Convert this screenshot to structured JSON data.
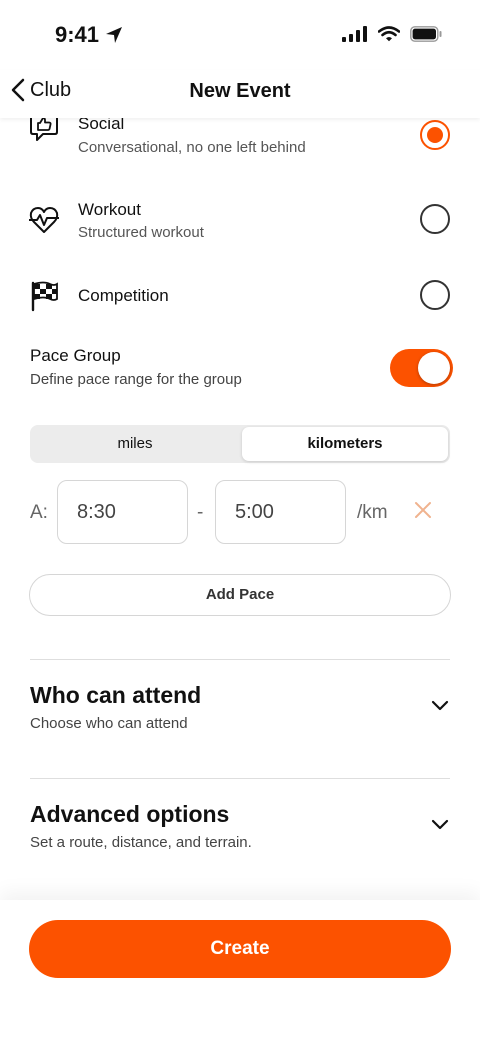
{
  "status_bar": {
    "time": "9:41"
  },
  "nav": {
    "back_label": "Club",
    "title": "New Event"
  },
  "event_types": [
    {
      "title": "Social",
      "subtitle": "Conversational, no one left behind",
      "selected": true,
      "icon": "thumbs-up-bubble-icon"
    },
    {
      "title": "Workout",
      "subtitle": "Structured workout",
      "selected": false,
      "icon": "heartbeat-icon"
    },
    {
      "title": "Competition",
      "subtitle": "",
      "selected": false,
      "icon": "checkered-flag-icon"
    }
  ],
  "pace_group": {
    "title": "Pace Group",
    "subtitle": "Define pace range for the group",
    "enabled": true
  },
  "units": {
    "options": [
      "miles",
      "kilometers"
    ],
    "selected": "kilometers"
  },
  "paces": [
    {
      "label": "A:",
      "from": "8:30",
      "separator": "-",
      "to": "5:00",
      "unit": "/km"
    }
  ],
  "add_pace_label": "Add Pace",
  "sections": [
    {
      "title": "Who can attend",
      "subtitle": "Choose who can attend"
    },
    {
      "title": "Advanced options",
      "subtitle": "Set a route, distance, and terrain."
    }
  ],
  "create_label": "Create",
  "colors": {
    "accent": "#fc5200",
    "remove_x": "#f0b38f"
  }
}
